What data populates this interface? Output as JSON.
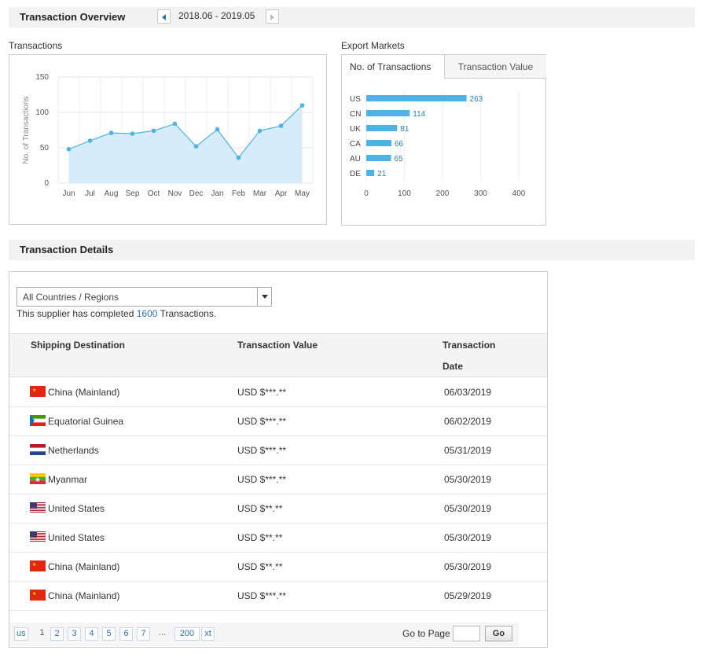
{
  "overview": {
    "title": "Transaction Overview",
    "date_range": "2018.06 - 2019.05"
  },
  "transactions_panel": {
    "label": "Transactions"
  },
  "export_panel": {
    "label": "Export Markets",
    "tabs": [
      {
        "label": "No. of Transactions",
        "active": true
      },
      {
        "label": "Transaction Value",
        "active": false
      }
    ]
  },
  "chart_data": [
    {
      "type": "area",
      "ylabel": "No. of Transactions",
      "categories": [
        "Jun",
        "Jul",
        "Aug",
        "Sep",
        "Oct",
        "Nov",
        "Dec",
        "Jan",
        "Feb",
        "Mar",
        "Apr",
        "May"
      ],
      "values": [
        48,
        60,
        71,
        70,
        74,
        84,
        52,
        76,
        36,
        74,
        81,
        110
      ],
      "ylim": [
        0,
        150
      ],
      "yticks": [
        "0",
        "50",
        "100",
        "150"
      ],
      "grid": true,
      "color": "#4db3e6",
      "fill": "#d6ecfa"
    },
    {
      "type": "bar",
      "orientation": "horizontal",
      "categories": [
        "US",
        "CN",
        "UK",
        "CA",
        "AU",
        "DE"
      ],
      "values": [
        263,
        114,
        81,
        66,
        65,
        21
      ],
      "labels": [
        "263",
        "114",
        "81",
        "66",
        "65",
        "21"
      ],
      "xlim": [
        0,
        400
      ],
      "xticks": [
        "0",
        "100",
        "200",
        "300",
        "400"
      ],
      "grid": true,
      "color": "#4db3e6"
    }
  ],
  "details": {
    "title": "Transaction Details",
    "filter_value": "All Countries / Regions",
    "summary_prefix": "This supplier has completed ",
    "summary_count": "1600",
    "summary_suffix": " Transactions.",
    "columns": [
      "Shipping Destination",
      "Transaction Value",
      "Transaction",
      "Date"
    ],
    "rows": [
      {
        "flag": "cn",
        "destination": "China (Mainland)",
        "value": "USD $***.**",
        "date": "06/03/2019"
      },
      {
        "flag": "gq",
        "destination": "Equatorial Guinea",
        "value": "USD $***.**",
        "date": "06/02/2019"
      },
      {
        "flag": "nl",
        "destination": "Netherlands",
        "value": "USD $***.**",
        "date": "05/31/2019"
      },
      {
        "flag": "mm",
        "destination": "Myanmar",
        "value": "USD $***.**",
        "date": "05/30/2019"
      },
      {
        "flag": "us",
        "destination": "United States",
        "value": "USD $**.**",
        "date": "05/30/2019"
      },
      {
        "flag": "us",
        "destination": "United States",
        "value": "USD $**.**",
        "date": "05/30/2019"
      },
      {
        "flag": "cn",
        "destination": "China (Mainland)",
        "value": "USD $**.**",
        "date": "05/30/2019"
      },
      {
        "flag": "cn",
        "destination": "China (Mainland)",
        "value": "USD $***.**",
        "date": "05/29/2019"
      }
    ]
  },
  "pagination": {
    "prev": "us",
    "current": "1",
    "pages": [
      "2",
      "3",
      "4",
      "5",
      "6",
      "7"
    ],
    "ellipsis": "...",
    "last": "200",
    "next": "xt",
    "goto_label": "Go to Page",
    "go_button": "Go"
  }
}
